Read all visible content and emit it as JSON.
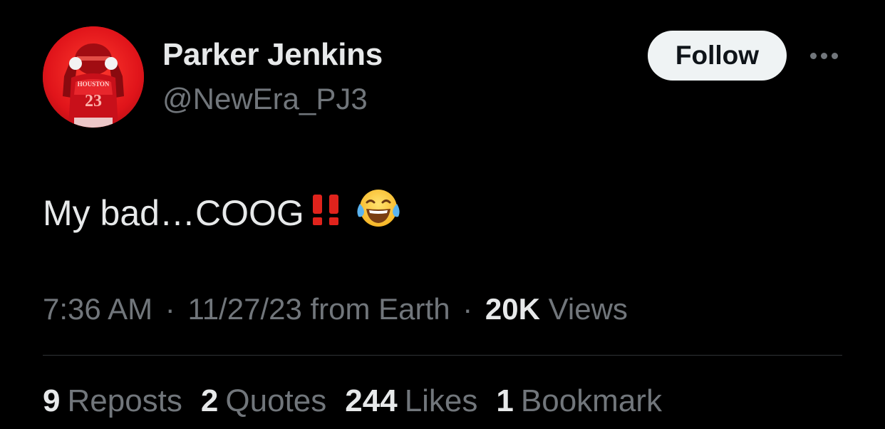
{
  "author": {
    "display_name": "Parker Jenkins",
    "handle": "@NewEra_PJ3",
    "avatar_icon": "profile-photo-football-player",
    "avatar_jersey_text": "HOUSTON",
    "avatar_jersey_number": "23"
  },
  "actions": {
    "follow_label": "Follow",
    "more_icon": "more-horizontal-icon"
  },
  "tweet": {
    "text": "My bad…COOG",
    "emojis": [
      "double-exclamation-mark",
      "face-with-tears-of-joy"
    ]
  },
  "meta": {
    "time": "7:36 AM",
    "separator": "·",
    "date_source": "11/27/23 from Earth",
    "views_count": "20K",
    "views_label": "Views"
  },
  "stats": [
    {
      "count": "9",
      "label": "Reposts"
    },
    {
      "count": "2",
      "label": "Quotes"
    },
    {
      "count": "244",
      "label": "Likes"
    },
    {
      "count": "1",
      "label": "Bookmark"
    }
  ],
  "colors": {
    "background": "#000000",
    "primary_text": "#e7e9ea",
    "secondary_text": "#71767b",
    "follow_bg": "#eff3f4",
    "follow_text": "#0f1419",
    "divider": "#2f3336",
    "avatar_red": "#e11d1d"
  }
}
